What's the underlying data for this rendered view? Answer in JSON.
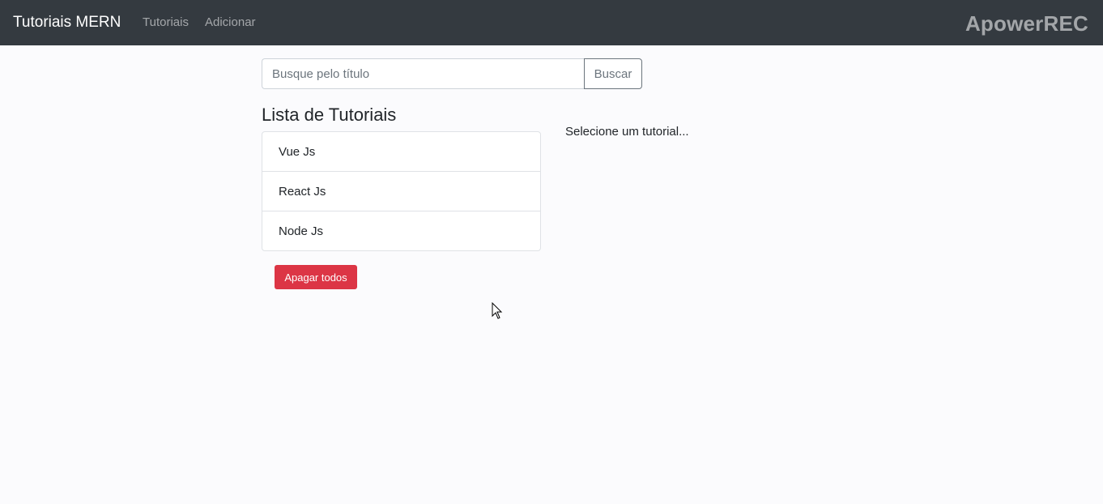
{
  "navbar": {
    "brand": "Tutoriais MERN",
    "links": [
      "Tutoriais",
      "Adicionar"
    ],
    "watermark": "ApowerREC",
    "background": "#343a40"
  },
  "search": {
    "placeholder": "Busque pelo título",
    "value": "",
    "button_label": "Buscar"
  },
  "tutorials": {
    "title": "Lista de Tutoriais",
    "items": [
      "Vue Js",
      "React Js",
      "Node Js"
    ],
    "delete_all_label": "Apagar todos",
    "delete_color": "#dc3545"
  },
  "details": {
    "message": "Selecione um tutorial..."
  },
  "icons": {
    "cursor": "mouse-pointer-icon"
  }
}
